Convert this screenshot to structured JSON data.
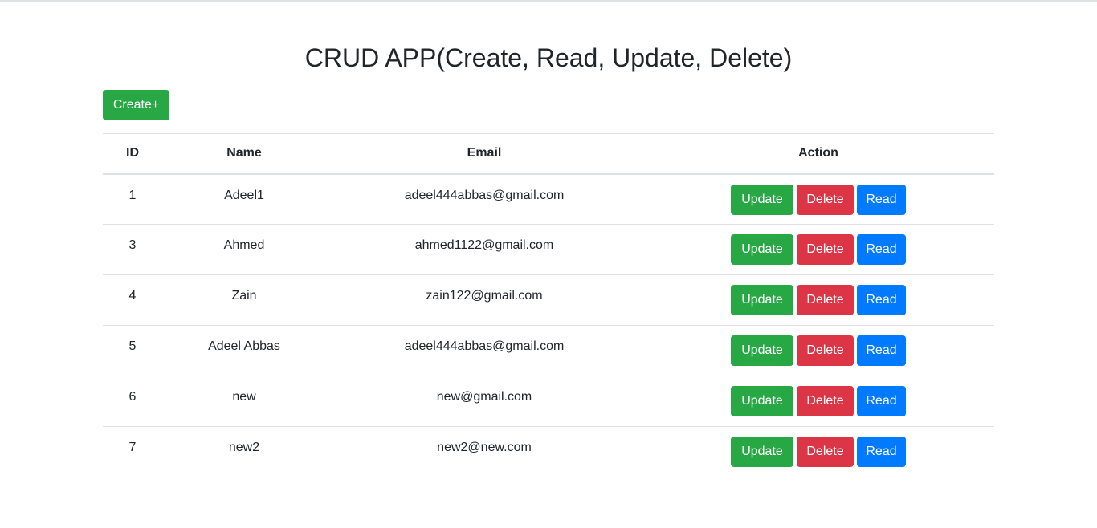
{
  "page": {
    "title": "CRUD APP(Create, Read, Update, Delete)",
    "create_label": "Create+"
  },
  "table": {
    "headers": {
      "id": "ID",
      "name": "Name",
      "email": "Email",
      "action": "Action"
    },
    "rows": [
      {
        "id": "1",
        "name": "Adeel1",
        "email": "adeel444abbas@gmail.com"
      },
      {
        "id": "3",
        "name": "Ahmed",
        "email": "ahmed1122@gmail.com"
      },
      {
        "id": "4",
        "name": "Zain",
        "email": "zain122@gmail.com"
      },
      {
        "id": "5",
        "name": "Adeel Abbas",
        "email": "adeel444abbas@gmail.com"
      },
      {
        "id": "6",
        "name": "new",
        "email": "new@gmail.com"
      },
      {
        "id": "7",
        "name": "new2",
        "email": "new2@new.com"
      }
    ],
    "actions": {
      "update": "Update",
      "delete": "Delete",
      "read": "Read"
    }
  },
  "colors": {
    "success": "#28a745",
    "danger": "#dc3545",
    "primary": "#007bff",
    "text": "#212529",
    "border": "#dee2e6"
  }
}
